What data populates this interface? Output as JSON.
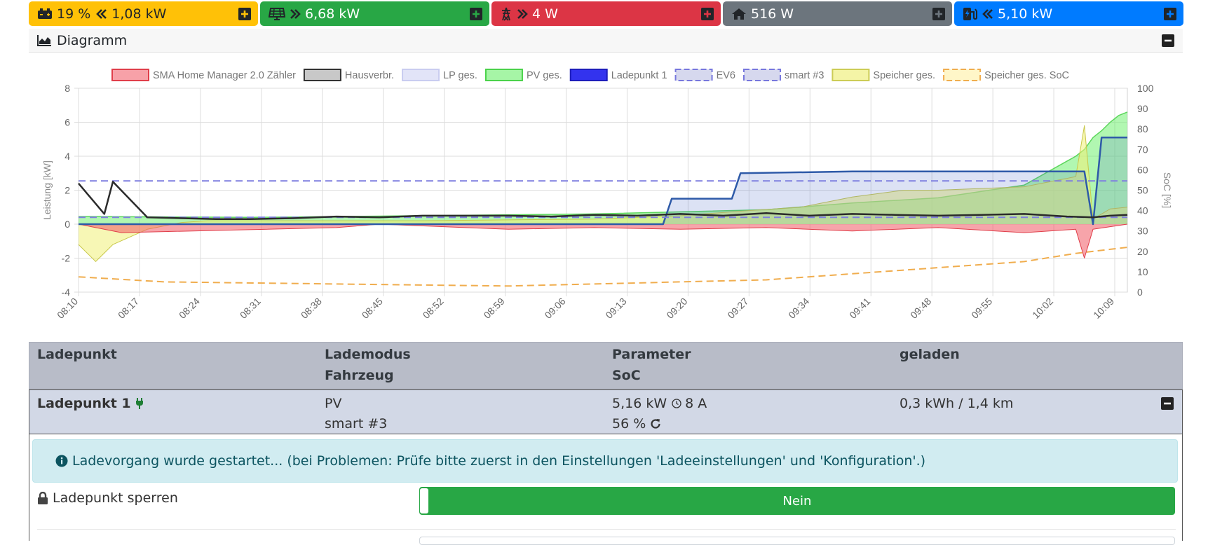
{
  "tiles": [
    {
      "key": "battery",
      "text": "19 %",
      "value": "1,08 kW",
      "dir": "left",
      "bg": "#ffc107",
      "fg": "#212529",
      "icon": "battery-icon"
    },
    {
      "key": "pv",
      "text": "",
      "value": "6,68 kW",
      "dir": "right",
      "bg": "#28a745",
      "fg": "#ffffff",
      "icon": "solar-panel-icon"
    },
    {
      "key": "grid",
      "text": "",
      "value": "4 W",
      "dir": "right",
      "bg": "#dc3545",
      "fg": "#ffffff",
      "icon": "power-pylon-icon"
    },
    {
      "key": "house",
      "text": "",
      "value": "516 W",
      "dir": "none",
      "bg": "#6c757d",
      "fg": "#ffffff",
      "icon": "home-icon"
    },
    {
      "key": "charge",
      "text": "",
      "value": "5,10 kW",
      "dir": "left",
      "bg": "#007bff",
      "fg": "#ffffff",
      "icon": "charging-station-icon"
    }
  ],
  "diagram": {
    "title": "Diagramm"
  },
  "chart_data": {
    "type": "area",
    "ylabel": "Leistung [kW]",
    "y2label": "SoC [%]",
    "ylim": [
      -4,
      8
    ],
    "y2lim": [
      0,
      100
    ],
    "yticks": [
      "8",
      "6",
      "4",
      "2",
      "0",
      "-2",
      "-4"
    ],
    "y2ticks": [
      "100",
      "90",
      "80",
      "70",
      "60",
      "50",
      "40",
      "30",
      "20",
      "10",
      "0"
    ],
    "xticks": [
      "08:10",
      "08:17",
      "08:24",
      "08:31",
      "08:38",
      "08:45",
      "08:52",
      "08:59",
      "09:06",
      "09:13",
      "09:20",
      "09:27",
      "09:34",
      "09:41",
      "09:48",
      "09:55",
      "10:02",
      "10:09"
    ],
    "legend_position": "top",
    "grid": true,
    "legend": [
      {
        "name": "SMA Home Manager 2.0 Zähler",
        "fill": "#f7a1a8",
        "stroke": "#e03e4a",
        "dash": false
      },
      {
        "name": "Hausverbr.",
        "fill": "#c8c8c8",
        "stroke": "#333333",
        "dash": false
      },
      {
        "name": "LP ges.",
        "fill": "#e2e4f8",
        "stroke": "#c9ccf0",
        "dash": false
      },
      {
        "name": "PV ges.",
        "fill": "#a6f5a6",
        "stroke": "#4ad24a",
        "dash": false
      },
      {
        "name": "Ladepunkt 1",
        "fill": "#3333ee",
        "stroke": "#1d1dbb",
        "dash": false
      },
      {
        "name": "EV6",
        "fill": "#d6d8ee",
        "stroke": "#7777dd",
        "dash": true
      },
      {
        "name": "smart #3",
        "fill": "#d6d8ee",
        "stroke": "#7777dd",
        "dash": true
      },
      {
        "name": "Speicher ges.",
        "fill": "#f4f4a6",
        "stroke": "#cccc55",
        "dash": false
      },
      {
        "name": "Speicher ges. SoC",
        "fill": "#fff6c8",
        "stroke": "#f0ad4e",
        "dash": true
      }
    ],
    "series": [
      {
        "name": "PV ges.",
        "axis": "left",
        "t": [
          0,
          20,
          40,
          60,
          80,
          90,
          100,
          110,
          116,
          117,
          118,
          119,
          120,
          121,
          122
        ],
        "y": [
          0.45,
          0.4,
          0.5,
          0.6,
          0.85,
          1.25,
          1.55,
          2.3,
          4.0,
          4.4,
          5.1,
          5.5,
          6.0,
          6.4,
          6.6
        ]
      },
      {
        "name": "Ladepunkt 1",
        "axis": "left",
        "t": [
          0,
          68,
          69,
          76,
          77,
          90,
          91,
          117,
          118,
          119,
          120,
          121,
          122
        ],
        "y": [
          0,
          0,
          1.5,
          1.5,
          3.0,
          3.1,
          3.1,
          3.1,
          0,
          5.1,
          5.1,
          5.1,
          5.1
        ]
      },
      {
        "name": "Hausverbr.",
        "axis": "left",
        "t": [
          0,
          3,
          4,
          8,
          12,
          16,
          20,
          25,
          30,
          35,
          40,
          45,
          50,
          55,
          60,
          65,
          70,
          75,
          80,
          85,
          90,
          95,
          100,
          105,
          110,
          115,
          118,
          120,
          122
        ],
        "y": [
          2.4,
          0.6,
          2.5,
          0.4,
          0.35,
          0.3,
          0.3,
          0.35,
          0.45,
          0.4,
          0.5,
          0.5,
          0.5,
          0.45,
          0.55,
          0.5,
          0.6,
          0.5,
          0.65,
          0.5,
          0.6,
          0.55,
          0.5,
          0.55,
          0.6,
          0.45,
          0.4,
          0.5,
          0.55
        ]
      },
      {
        "name": "Speicher ges.",
        "axis": "left",
        "t": [
          0,
          2,
          4,
          8,
          12,
          15,
          20,
          40,
          60,
          70,
          78,
          84,
          90,
          96,
          100,
          105,
          110,
          116,
          117,
          118,
          120,
          122
        ],
        "y": [
          -1.2,
          -2.2,
          -1.2,
          -0.3,
          0.1,
          0.2,
          0.2,
          0.2,
          0.3,
          0.5,
          0.8,
          1.0,
          1.6,
          2.0,
          2.0,
          2.1,
          2.2,
          2.8,
          5.8,
          0.3,
          0.9,
          1.0
        ]
      },
      {
        "name": "SMA Home Manager 2.0 Zähler",
        "axis": "left",
        "t": [
          0,
          5,
          30,
          35,
          50,
          60,
          70,
          80,
          90,
          100,
          110,
          116,
          117,
          118,
          122
        ],
        "y": [
          0,
          -0.5,
          -0.2,
          0,
          -0.3,
          -0.2,
          -0.3,
          -0.2,
          -0.4,
          -0.2,
          -0.5,
          -0.3,
          -2.0,
          -0.3,
          0
        ]
      },
      {
        "name": "EV6",
        "axis": "left",
        "t": [
          0,
          122
        ],
        "y": [
          2.55,
          2.55
        ]
      },
      {
        "name": "smart #3",
        "axis": "left",
        "t": [
          0,
          122
        ],
        "y": [
          0.4,
          0.4
        ]
      },
      {
        "name": "Speicher ges. SoC",
        "axis": "right",
        "t": [
          0,
          10,
          30,
          50,
          60,
          70,
          80,
          90,
          100,
          110,
          116,
          120,
          122
        ],
        "y": [
          7.5,
          5,
          4,
          3,
          4,
          5,
          6,
          9,
          12,
          15,
          19,
          21,
          22
        ]
      }
    ]
  },
  "table": {
    "headers": [
      "Ladepunkt",
      "Lademodus",
      "Parameter",
      "geladen"
    ],
    "subheaders": [
      "Fahrzeug",
      "SoC"
    ]
  },
  "lp": {
    "name": "Ladepunkt 1",
    "mode": "PV",
    "vehicle": "smart #3",
    "power": "5,16 kW",
    "current": "8 A",
    "soc": "56 %",
    "charged": "0,3 kWh / 1,4 km"
  },
  "alert": {
    "text": "Ladevorgang wurde gestartet... (bei Problemen: Prüfe bitte zuerst in den Einstellungen 'Ladeeinstellungen' und 'Konfiguration'.)"
  },
  "lock": {
    "label": "Ladepunkt sperren",
    "value": "Nein"
  }
}
